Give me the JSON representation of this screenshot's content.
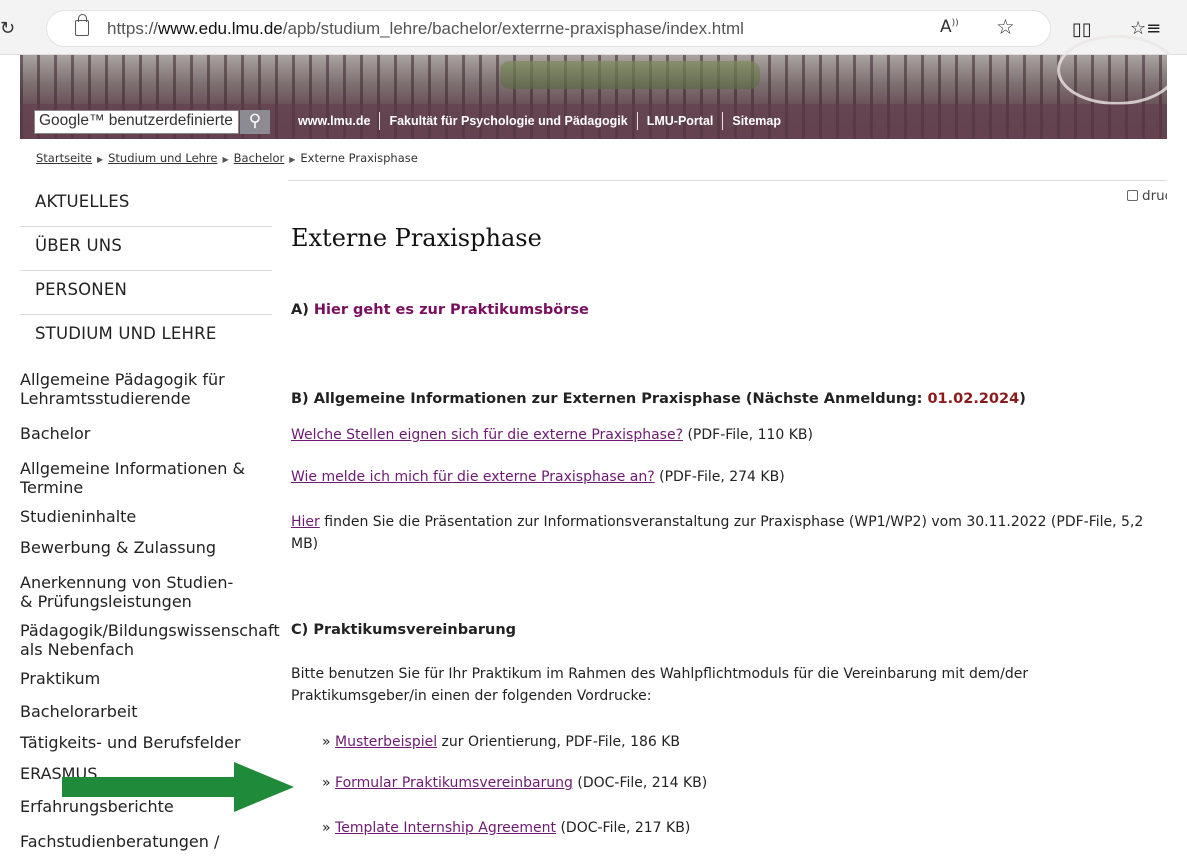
{
  "browser": {
    "url_prefix": "https://",
    "url_domain": "www.edu.lmu.de",
    "url_path": "/apb/studium_lehre/bachelor/exterrne-praxisphase/index.html",
    "read_aloud_icon": "read-aloud-icon",
    "favorite_icon": "star-icon"
  },
  "header": {
    "search_placeholder": "Google™ benutzerdefinierte",
    "search_icon": "search-icon",
    "links": [
      "www.lmu.de",
      "Fakultät für Psychologie und Pädagogik",
      "LMU-Portal",
      "Sitemap"
    ]
  },
  "breadcrumb": [
    "Startseite",
    "Studium und Lehre",
    "Bachelor",
    "Externe Praxisphase"
  ],
  "print_label": "drucke",
  "sidebar": {
    "categories": [
      "AKTUELLES",
      "ÜBER UNS",
      "PERSONEN",
      "STUDIUM UND LEHRE"
    ],
    "items": [
      {
        "level": 1,
        "label": "Allgemeine Pädagogik für Lehramtsstudierende"
      },
      {
        "level": 1,
        "label": "Bachelor"
      },
      {
        "level": 2,
        "label": "Allgemeine Informationen & Termine"
      },
      {
        "level": 2,
        "label": "Studieninhalte"
      },
      {
        "level": 2,
        "label": "Bewerbung & Zulassung"
      },
      {
        "level": 2,
        "label": "Anerkennung von Studien- & Prüfungsleistungen"
      },
      {
        "level": 2,
        "label": "Pädagogik/Bildungswissenschaft als Nebenfach"
      },
      {
        "level": 2,
        "label": "Praktikum"
      },
      {
        "level": 2,
        "label": "Bachelorarbeit"
      },
      {
        "level": 2,
        "label": "Tätigkeits- und Berufsfelder"
      },
      {
        "level": 1,
        "label": "ERASMUS"
      },
      {
        "level": 1,
        "label": "Erfahrungsberichte"
      },
      {
        "level": 1,
        "label": "Fachstudienberatungen /"
      }
    ]
  },
  "main": {
    "title": "Externe Praxisphase",
    "section_a": {
      "prefix": "A) ",
      "link": "Hier geht es zur Praktikumsbörse"
    },
    "section_b": {
      "text": "B) Allgemeine Informationen zur Externen Praxisphase (Nächste Anmeldung: ",
      "date": "01.02.2024",
      "close": ")"
    },
    "b_links": [
      {
        "link": "Welche Stellen eignen sich für die externe Praxisphase?",
        "info": " (PDF-File, 110 KB)"
      },
      {
        "link": "Wie melde ich mich für die externe Praxisphase an?",
        "info": " (PDF-File, 274 KB)"
      },
      {
        "link": "Hier",
        "info": " finden Sie die Präsentation zur Informationsveranstaltung zur Praxisphase (WP1/WP2) vom 30.11.2022 (PDF-File, 5,2 MB)"
      }
    ],
    "section_c": "C) Praktikumsvereinbarung",
    "c_text": "Bitte benutzen Sie für Ihr Praktikum im Rahmen des Wahlpflichtmoduls für die Vereinbarung mit dem/der Praktikumsgeber/in einen der folgenden Vordrucke:",
    "c_links": [
      {
        "link": "Musterbeispiel",
        "info": " zur Orientierung, PDF-File, 186 KB"
      },
      {
        "link": "Formular Praktikumsvereinbarung",
        "info": " (DOC-File, 214 KB)"
      },
      {
        "link": "Template Internship Agreement",
        "info": " (DOC-File, 217 KB)"
      }
    ],
    "bullet": "»"
  },
  "colors": {
    "accent": "#7a0e5e",
    "date_red": "#8b1a1a",
    "arrow_green": "#1f8a3a",
    "link": "#6d1b71"
  }
}
